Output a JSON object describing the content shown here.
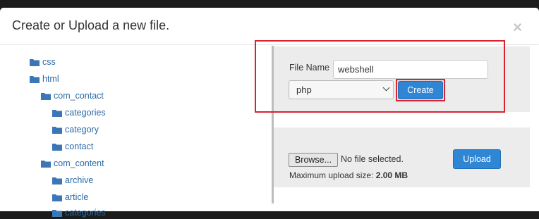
{
  "dialog": {
    "title": "Create or Upload a new file.",
    "close_label": "×"
  },
  "tree": {
    "items": [
      {
        "label": "css"
      },
      {
        "label": "html"
      },
      {
        "label": "com_contact"
      },
      {
        "label": "categories"
      },
      {
        "label": "category"
      },
      {
        "label": "contact"
      },
      {
        "label": "com_content"
      },
      {
        "label": "archive"
      },
      {
        "label": "article"
      },
      {
        "label": "categories"
      }
    ]
  },
  "create_form": {
    "file_name_label": "File Name",
    "file_name_value": "webshell",
    "extension_selected": "php",
    "create_label": "Create"
  },
  "upload_form": {
    "browse_label": "Browse...",
    "no_file_text": "No file selected.",
    "max_size_label": "Maximum upload size:",
    "max_size_value": "2.00 MB",
    "upload_label": "Upload"
  },
  "colors": {
    "link": "#2a6aa8",
    "primary": "#2f86d4",
    "highlight": "#d9232e"
  }
}
